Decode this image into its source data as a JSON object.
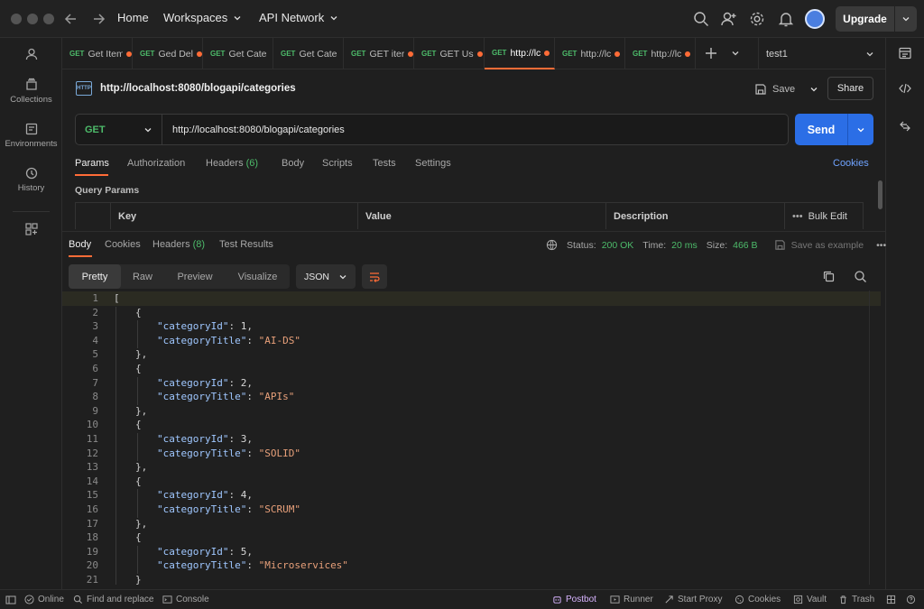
{
  "topbar": {
    "home": "Home",
    "workspaces": "Workspaces",
    "api_network": "API Network",
    "upgrade": "Upgrade"
  },
  "sidebar": {
    "items": [
      {
        "label": "",
        "icon": "user-icon"
      },
      {
        "label": "Collections",
        "icon": "collections-icon"
      },
      {
        "label": "Environments",
        "icon": "environments-icon"
      },
      {
        "label": "History",
        "icon": "history-icon"
      },
      {
        "label": "",
        "icon": "add-workspace-icon"
      }
    ]
  },
  "tabs": [
    {
      "method": "GET",
      "title": "Get Item",
      "unsaved": true
    },
    {
      "method": "GET",
      "title": "Ged Del",
      "unsaved": true
    },
    {
      "method": "GET",
      "title": "Get Cate",
      "unsaved": false
    },
    {
      "method": "GET",
      "title": "Get Cate",
      "unsaved": false
    },
    {
      "method": "GET",
      "title": "GET iter",
      "unsaved": true
    },
    {
      "method": "GET",
      "title": "GET Us",
      "unsaved": true
    },
    {
      "method": "GET",
      "title": "http://lc",
      "unsaved": true,
      "active": true
    },
    {
      "method": "GET",
      "title": "http://lc",
      "unsaved": true
    },
    {
      "method": "GET",
      "title": "http://lc",
      "unsaved": true
    }
  ],
  "environment": "test1",
  "request": {
    "icon_text": "HTTP",
    "name": "http://localhost:8080/blogapi/categories",
    "save": "Save",
    "share": "Share",
    "method": "GET",
    "url": "http://localhost:8080/blogapi/categories",
    "send": "Send"
  },
  "request_tabs": {
    "params": "Params",
    "authorization": "Authorization",
    "headers": "Headers",
    "headers_count": "(6)",
    "body": "Body",
    "scripts": "Scripts",
    "tests": "Tests",
    "settings": "Settings",
    "cookies": "Cookies"
  },
  "query_params": {
    "title": "Query Params",
    "columns": [
      "Key",
      "Value",
      "Description"
    ],
    "bulk_edit": "Bulk Edit"
  },
  "response_tabs": {
    "body": "Body",
    "cookies": "Cookies",
    "headers": "Headers",
    "headers_count": "(8)",
    "test_results": "Test Results"
  },
  "response_status": {
    "status_label": "Status:",
    "status": "200 OK",
    "time_label": "Time:",
    "time": "20 ms",
    "size_label": "Size:",
    "size": "466 B",
    "save_example": "Save as example"
  },
  "response_view": {
    "modes": [
      "Pretty",
      "Raw",
      "Preview",
      "Visualize"
    ],
    "active_mode": "Pretty",
    "format": "JSON"
  },
  "response_lines": [
    {
      "n": "1",
      "indent": 0,
      "parts": [
        [
          "p",
          "["
        ]
      ]
    },
    {
      "n": "2",
      "indent": 1,
      "parts": [
        [
          "p",
          "{"
        ]
      ]
    },
    {
      "n": "3",
      "indent": 2,
      "parts": [
        [
          "k",
          "\"categoryId\""
        ],
        [
          "p",
          ": "
        ],
        [
          "n",
          "1"
        ],
        [
          "p",
          ","
        ]
      ]
    },
    {
      "n": "4",
      "indent": 2,
      "parts": [
        [
          "k",
          "\"categoryTitle\""
        ],
        [
          "p",
          ": "
        ],
        [
          "s",
          "\"AI-DS\""
        ]
      ]
    },
    {
      "n": "5",
      "indent": 1,
      "parts": [
        [
          "p",
          "},"
        ]
      ]
    },
    {
      "n": "6",
      "indent": 1,
      "parts": [
        [
          "p",
          "{"
        ]
      ]
    },
    {
      "n": "7",
      "indent": 2,
      "parts": [
        [
          "k",
          "\"categoryId\""
        ],
        [
          "p",
          ": "
        ],
        [
          "n",
          "2"
        ],
        [
          "p",
          ","
        ]
      ]
    },
    {
      "n": "8",
      "indent": 2,
      "parts": [
        [
          "k",
          "\"categoryTitle\""
        ],
        [
          "p",
          ": "
        ],
        [
          "s",
          "\"APIs\""
        ]
      ]
    },
    {
      "n": "9",
      "indent": 1,
      "parts": [
        [
          "p",
          "},"
        ]
      ]
    },
    {
      "n": "10",
      "indent": 1,
      "parts": [
        [
          "p",
          "{"
        ]
      ]
    },
    {
      "n": "11",
      "indent": 2,
      "parts": [
        [
          "k",
          "\"categoryId\""
        ],
        [
          "p",
          ": "
        ],
        [
          "n",
          "3"
        ],
        [
          "p",
          ","
        ]
      ]
    },
    {
      "n": "12",
      "indent": 2,
      "parts": [
        [
          "k",
          "\"categoryTitle\""
        ],
        [
          "p",
          ": "
        ],
        [
          "s",
          "\"SOLID\""
        ]
      ]
    },
    {
      "n": "13",
      "indent": 1,
      "parts": [
        [
          "p",
          "},"
        ]
      ]
    },
    {
      "n": "14",
      "indent": 1,
      "parts": [
        [
          "p",
          "{"
        ]
      ]
    },
    {
      "n": "15",
      "indent": 2,
      "parts": [
        [
          "k",
          "\"categoryId\""
        ],
        [
          "p",
          ": "
        ],
        [
          "n",
          "4"
        ],
        [
          "p",
          ","
        ]
      ]
    },
    {
      "n": "16",
      "indent": 2,
      "parts": [
        [
          "k",
          "\"categoryTitle\""
        ],
        [
          "p",
          ": "
        ],
        [
          "s",
          "\"SCRUM\""
        ]
      ]
    },
    {
      "n": "17",
      "indent": 1,
      "parts": [
        [
          "p",
          "},"
        ]
      ]
    },
    {
      "n": "18",
      "indent": 1,
      "parts": [
        [
          "p",
          "{"
        ]
      ]
    },
    {
      "n": "19",
      "indent": 2,
      "parts": [
        [
          "k",
          "\"categoryId\""
        ],
        [
          "p",
          ": "
        ],
        [
          "n",
          "5"
        ],
        [
          "p",
          ","
        ]
      ]
    },
    {
      "n": "20",
      "indent": 2,
      "parts": [
        [
          "k",
          "\"categoryTitle\""
        ],
        [
          "p",
          ": "
        ],
        [
          "s",
          "\"Microservices\""
        ]
      ]
    },
    {
      "n": "21",
      "indent": 1,
      "parts": [
        [
          "p",
          "}"
        ]
      ]
    }
  ],
  "statusbar": {
    "online": "Online",
    "find_replace": "Find and replace",
    "console": "Console",
    "postbot": "Postbot",
    "runner": "Runner",
    "start_proxy": "Start Proxy",
    "cookies": "Cookies",
    "vault": "Vault",
    "trash": "Trash"
  },
  "colors": {
    "accent": "#ff6c37",
    "send": "#2b6ee6",
    "get_method": "#4dbb6a",
    "link": "#6fa3ff"
  }
}
